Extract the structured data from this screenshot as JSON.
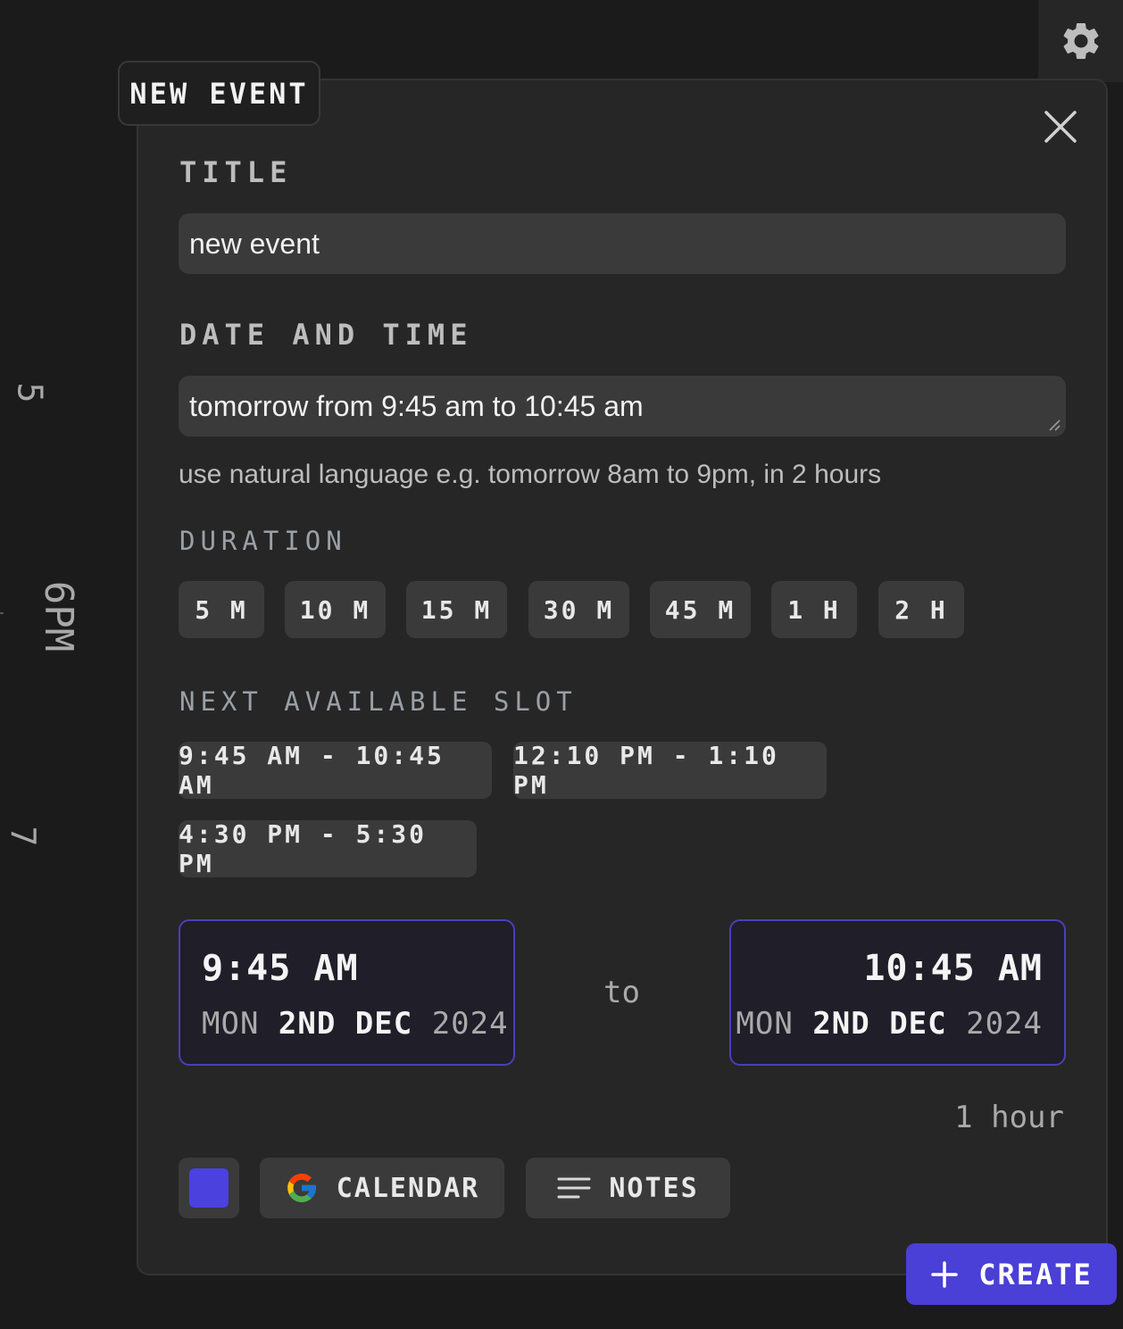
{
  "header": {
    "settings_icon": "gear-icon"
  },
  "timeline": {
    "hours": [
      "5",
      "6PM",
      "7"
    ]
  },
  "dialog": {
    "tab_label": "NEW EVENT",
    "close_icon": "close-icon",
    "title_label": "TITLE",
    "title_value": "new event",
    "datetime_label": "DATE AND TIME",
    "datetime_value": "tomorrow from 9:45 am to 10:45 am",
    "datetime_hint": "use natural language e.g. tomorrow 8am to 9pm, in 2 hours",
    "duration_label": "DURATION",
    "durations": [
      "5 M",
      "10 M",
      "15 M",
      "30 M",
      "45 M",
      "1 H",
      "2 H"
    ],
    "slots_label": "NEXT AVAILABLE SLOT",
    "slots": [
      "9:45 AM - 10:45 AM",
      "12:10 PM - 1:10 PM",
      "4:30 PM - 5:30 PM"
    ],
    "start": {
      "time": "9:45 AM",
      "weekday": "MON",
      "day": "2ND DEC",
      "year": "2024"
    },
    "to_word": "to",
    "end": {
      "time": "10:45 AM",
      "weekday": "MON",
      "day": "2ND DEC",
      "year": "2024"
    },
    "duration_text": "1 hour",
    "color_value": "#4a41de",
    "calendar_label": "CALENDAR",
    "notes_label": "NOTES",
    "create_label": "CREATE"
  },
  "colors": {
    "accent": "#4a3fd6",
    "border_accent": "#4a3fb8"
  }
}
